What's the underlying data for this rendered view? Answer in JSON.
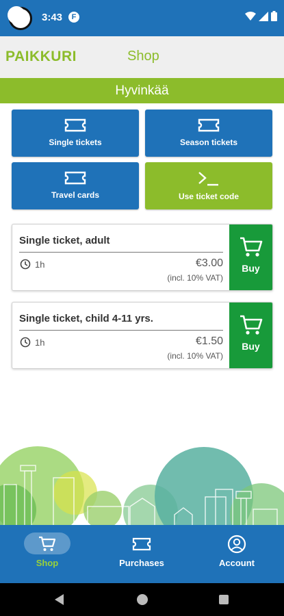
{
  "status_bar": {
    "time": "3:43",
    "app_icon": "f-circle-icon",
    "wifi_icon": "wifi-icon",
    "signal_icon": "signal-icon",
    "battery_icon": "battery-icon"
  },
  "header": {
    "brand": "PAIKKURI",
    "title": "Shop"
  },
  "region": "Hyvinkää",
  "tiles": [
    {
      "label": "Single tickets",
      "icon": "ticket-icon",
      "color": "#1f72b8"
    },
    {
      "label": "Season tickets",
      "icon": "ticket-icon",
      "color": "#1f72b8"
    },
    {
      "label": "Travel cards",
      "icon": "ticket-icon",
      "color": "#1f72b8"
    },
    {
      "label": "Use ticket code",
      "icon": "terminal-icon",
      "color": "#8cbc2b"
    }
  ],
  "tickets": [
    {
      "name": "Single ticket, adult",
      "duration": "1h",
      "price": "€3.00",
      "vat": "(incl. 10% VAT)",
      "buy_label": "Buy"
    },
    {
      "name": "Single ticket, child 4-11 yrs.",
      "duration": "1h",
      "price": "€1.50",
      "vat": "(incl. 10% VAT)",
      "buy_label": "Buy"
    }
  ],
  "bottom_nav": [
    {
      "label": "Shop",
      "icon": "cart-icon",
      "active": true
    },
    {
      "label": "Purchases",
      "icon": "ticket-icon",
      "active": false
    },
    {
      "label": "Account",
      "icon": "account-icon",
      "active": false
    }
  ],
  "colors": {
    "primary_blue": "#1f72b8",
    "accent_green": "#8cbc2b",
    "buy_green": "#189a3a",
    "active_nav_label": "#9ad23a"
  }
}
